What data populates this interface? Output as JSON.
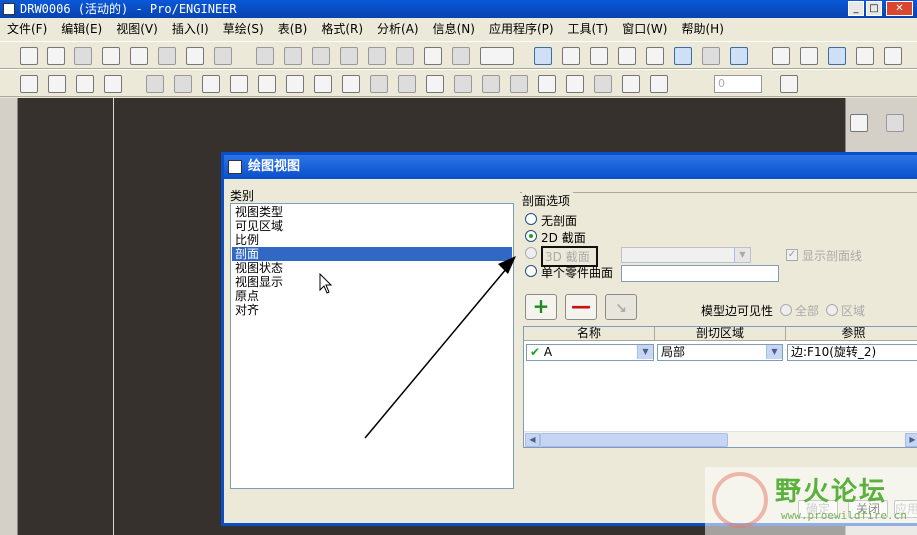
{
  "window": {
    "title": "DRW0006 (活动的) - Pro/ENGINEER",
    "min_label": "_",
    "max_label": "□",
    "close_label": "✕"
  },
  "menu": [
    "文件(F)",
    "编辑(E)",
    "视图(V)",
    "插入(I)",
    "草绘(S)",
    "表(B)",
    "格式(R)",
    "分析(A)",
    "信息(N)",
    "应用程序(P)",
    "工具(T)",
    "窗口(W)",
    "帮助(H)"
  ],
  "toolbar": {
    "spin_value": "0"
  },
  "dialog": {
    "title": "绘图视图",
    "category_label": "类别",
    "categories": [
      "视图类型",
      "可见区域",
      "比例",
      "剖面",
      "视图状态",
      "视图显示",
      "原点",
      "对齐"
    ],
    "selected_category": "剖面",
    "section_options_label": "剖面选项",
    "options": {
      "no_section": "无剖面",
      "section_2d": "2D 截面",
      "section_3d": "3D 截面",
      "single_surface": "单个零件曲面"
    },
    "show_section_line": "显示剖面线",
    "model_edge_visibility": "模型边可见性",
    "vis_all": "全部",
    "vis_area": "区域",
    "add_btn": "+",
    "remove_btn": "—",
    "table": {
      "headers": [
        "名称",
        "剖切区域",
        "参照"
      ],
      "row": {
        "name": "A",
        "region": "局部",
        "reference": "边:F10(旋转_2)"
      }
    },
    "ok": "确定",
    "close": "关闭",
    "apply": "应用"
  },
  "watermark": {
    "text": "野火论坛",
    "url": "www.proewildfire.cn"
  },
  "colors": {
    "title_bar": "#0a4fc9",
    "selection": "#3167c5",
    "canvas": "#36312c"
  }
}
